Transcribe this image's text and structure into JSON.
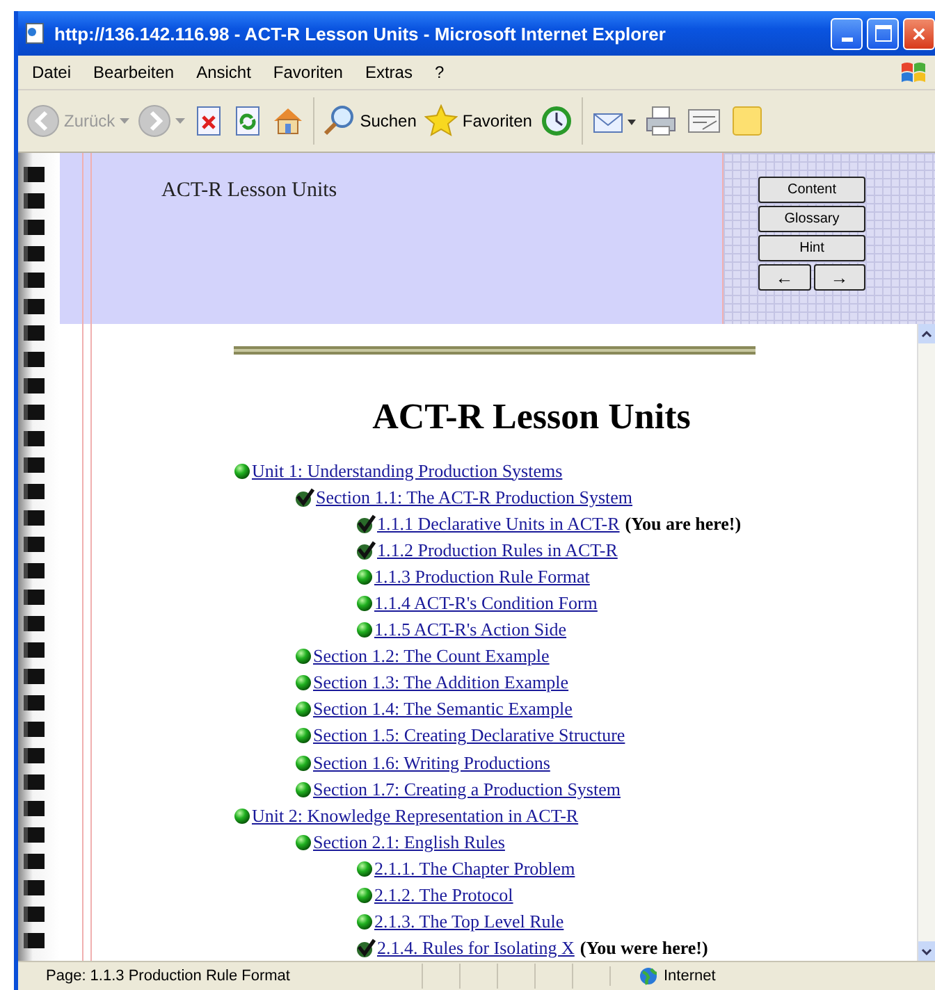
{
  "window": {
    "title": "http://136.142.116.98 - ACT-R Lesson Units - Microsoft Internet Explorer"
  },
  "menu": [
    "Datei",
    "Bearbeiten",
    "Ansicht",
    "Favoriten",
    "Extras",
    "?"
  ],
  "toolbar": [
    {
      "kind": "back",
      "label": "Zurück",
      "disabled": true
    },
    {
      "kind": "forward"
    },
    {
      "kind": "stop"
    },
    {
      "kind": "refresh"
    },
    {
      "kind": "home"
    },
    {
      "kind": "search",
      "label": "Suchen"
    },
    {
      "kind": "favorites",
      "label": "Favoriten"
    },
    {
      "kind": "history"
    },
    {
      "kind": "mail"
    },
    {
      "kind": "print"
    },
    {
      "kind": "edit"
    },
    {
      "kind": "note"
    }
  ],
  "header": {
    "title": "ACT-R Lesson Units",
    "buttons": [
      "Content",
      "Glossary",
      "Hint"
    ],
    "arrows": [
      "←",
      "→"
    ]
  },
  "heading": "ACT-R Lesson Units",
  "tree": [
    {
      "label": "Unit 1: Understanding Production Systems",
      "done": false,
      "children": [
        {
          "label": "Section 1.1: The ACT-R Production System",
          "done": true,
          "children": [
            {
              "label": "1.1.1 Declarative Units in ACT-R",
              "done": true,
              "note": "(You are here!)"
            },
            {
              "label": "1.1.2 Production Rules in ACT-R",
              "done": true
            },
            {
              "label": "1.1.3 Production Rule Format",
              "done": false
            },
            {
              "label": "1.1.4 ACT-R's Condition Form",
              "done": false
            },
            {
              "label": "1.1.5 ACT-R's Action Side",
              "done": false
            }
          ]
        },
        {
          "label": "Section 1.2: The Count Example",
          "done": false
        },
        {
          "label": "Section 1.3: The Addition Example",
          "done": false
        },
        {
          "label": "Section 1.4: The Semantic Example",
          "done": false
        },
        {
          "label": "Section 1.5: Creating Declarative Structure",
          "done": false
        },
        {
          "label": "Section 1.6: Writing Productions",
          "done": false
        },
        {
          "label": "Section 1.7: Creating a Production System",
          "done": false
        }
      ]
    },
    {
      "label": "Unit 2: Knowledge Representation in ACT-R",
      "done": false,
      "children": [
        {
          "label": "Section 2.1: English Rules",
          "done": false,
          "children": [
            {
              "label": "2.1.1. The Chapter Problem",
              "done": false
            },
            {
              "label": "2.1.2. The Protocol",
              "done": false
            },
            {
              "label": "2.1.3. The Top Level Rule",
              "done": false
            },
            {
              "label": "2.1.4. Rules for Isolating X",
              "done": true,
              "note": "(You were here!)"
            }
          ]
        }
      ]
    }
  ],
  "status_bar": {
    "text": "Page: 1.1.3 Production Rule Format",
    "zone": "Internet"
  }
}
